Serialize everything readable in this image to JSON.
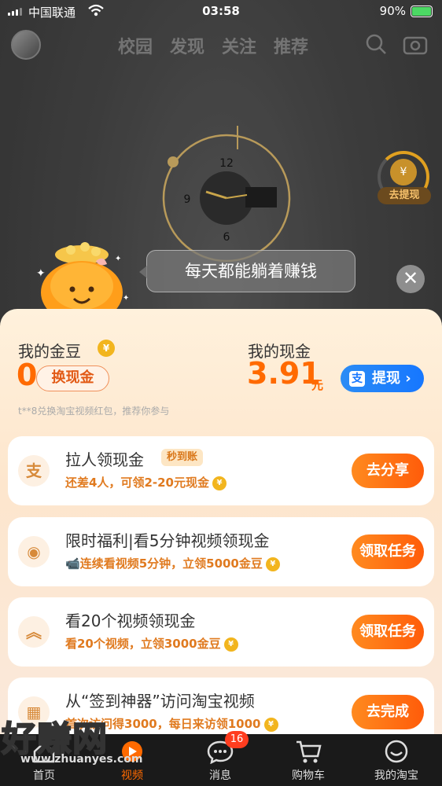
{
  "status_bar": {
    "carrier": "中国联通",
    "time": "03:58",
    "battery": "90%"
  },
  "top_nav": {
    "tabs": [
      "校园",
      "发现",
      "关注",
      "推荐"
    ]
  },
  "cash_widget": {
    "label": "去提现",
    "symbol": "¥",
    "progress": 0.3
  },
  "speech_bubble": "每天都能躺着赚钱",
  "close": "✕",
  "wallet": {
    "coins_label": "我的金豆",
    "coins_badge": "¥",
    "coins_value": "0",
    "exchange_button": "换现金",
    "cash_label": "我的现金",
    "cash_value": "3.91",
    "cash_unit": "元",
    "withdraw_button": "提现",
    "withdraw_icon": "支",
    "hint": "t**8兑换淘宝视频红包，推荐你参与"
  },
  "tasks": [
    {
      "icon": "支",
      "title": "拉人领现金",
      "tag": "秒到账",
      "subtitle": "还差4人，可领2-20元现金",
      "action": "去分享"
    },
    {
      "icon": "◉",
      "title": "限时福利|看5分钟视频领现金",
      "tag": "",
      "subtitle": "连续看视频5分钟，立领5000金豆",
      "action": "领取任务"
    },
    {
      "icon": "︽",
      "title": "看20个视频领现金",
      "tag": "",
      "subtitle": "看20个视频，立领3000金豆",
      "action": "领取任务"
    },
    {
      "icon": "▦",
      "title": "从“签到神器”访问淘宝视频",
      "tag": "",
      "subtitle": "首次访问得3000，每日来访领1000",
      "action": "去完成"
    }
  ],
  "coin_symbol": "¥",
  "tab_bar": {
    "items": [
      {
        "label": "首页",
        "icon": "home-icon"
      },
      {
        "label": "视频",
        "icon": "video-icon"
      },
      {
        "label": "消息",
        "icon": "message-icon",
        "badge": "16"
      },
      {
        "label": "购物车",
        "icon": "cart-icon"
      },
      {
        "label": "我的淘宝",
        "icon": "profile-icon"
      }
    ]
  },
  "watermark": {
    "text": "好赚网",
    "url": "www.zhuanyes.com"
  }
}
